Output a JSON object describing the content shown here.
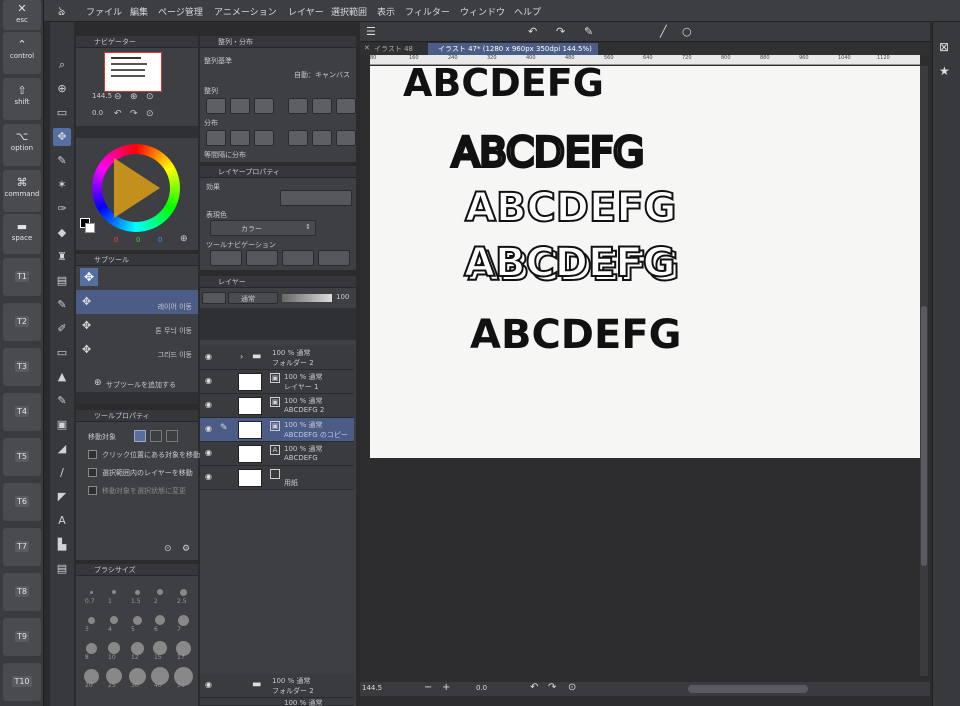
{
  "shortcut_bar": {
    "keys": [
      {
        "glyph": "✕",
        "label": "esc"
      },
      {
        "glyph": "⌃",
        "label": "control"
      },
      {
        "glyph": "⇧",
        "label": "shift"
      },
      {
        "glyph": "⌥",
        "label": "option"
      },
      {
        "glyph": "⌘",
        "label": "command"
      },
      {
        "glyph": "▬",
        "label": "space"
      }
    ],
    "tkeys": [
      "T1",
      "T2",
      "T3",
      "T4",
      "T5",
      "T6",
      "T7",
      "T8",
      "T9",
      "T10"
    ]
  },
  "menu": [
    "ファイル",
    "編集",
    "ページ管理",
    "アニメーション",
    "レイヤー",
    "選択範囲",
    "表示",
    "フィルター",
    "ウィンドウ",
    "ヘルプ"
  ],
  "navigator": {
    "title": "ナビゲーター",
    "zoom": "144.5",
    "rotation": "0.0"
  },
  "color_values": [
    "0",
    "0",
    "0"
  ],
  "subtool": {
    "title": "サブツール",
    "items": [
      "레이어 이동",
      "톤 무늬 이동",
      "그리드 이동"
    ],
    "add_label": "サブツールを追加する"
  },
  "tool_property": {
    "title": "ツールプロパティ",
    "target_label": "移動対象",
    "checks": [
      "クリック位置にある対象を移動",
      "選択範囲内のレイヤーを移動",
      "移動対象を選択状態に変更"
    ]
  },
  "brush_size": {
    "title": "ブラシサイズ",
    "sizes": [
      "0.7",
      "1",
      "1.5",
      "2",
      "2.5",
      "3",
      "4",
      "5",
      "6",
      "7",
      "8",
      "10",
      "12",
      "15",
      "17",
      "20",
      "25",
      "30",
      "40",
      "50"
    ]
  },
  "align": {
    "title": "整列・分布",
    "base_label": "整列基準",
    "auto_label": "自動：キャンバス",
    "align_label": "整列",
    "distribute_label": "分布",
    "equal_label": "等間隔に分布"
  },
  "layer_property": {
    "title": "レイヤープロパティ",
    "effect_label": "効果",
    "expression_label": "表現色",
    "expression_value": "カラー",
    "toolnav_label": "ツールナビゲーション"
  },
  "layers": {
    "title": "レイヤー",
    "blend": "通常",
    "opacity": "100",
    "items": [
      {
        "meta": "100 % 通常",
        "name": "フォルダー 2",
        "kind": "folder"
      },
      {
        "meta": "100 % 通常",
        "name": "レイヤー 1",
        "kind": "raster"
      },
      {
        "meta": "100 % 通常",
        "name": "ABCDEFG 2",
        "kind": "raster"
      },
      {
        "meta": "100 % 通常",
        "name": "ABCDEFG のコピー",
        "kind": "raster",
        "selected": true
      },
      {
        "meta": "100 % 通常",
        "name": "ABCDEFG",
        "kind": "text"
      },
      {
        "meta": "",
        "name": "用紙",
        "kind": "paper"
      }
    ],
    "bottom": {
      "meta": "100 % 通常",
      "name": "フォルダー 2"
    },
    "bottom2": "100 % 通常"
  },
  "tabs": [
    {
      "label": "イラスト 48"
    },
    {
      "label": "イラスト 47* (1280 x 960px 350dpi 144.5%)"
    }
  ],
  "ruler_ticks": [
    "80",
    "160",
    "240",
    "320",
    "400",
    "480",
    "560",
    "640",
    "720",
    "800",
    "880",
    "960",
    "1040",
    "1120"
  ],
  "canvas_text": {
    "line": "ABCDEFG"
  },
  "status": {
    "zoom": "144.5",
    "angle": "0.0"
  }
}
